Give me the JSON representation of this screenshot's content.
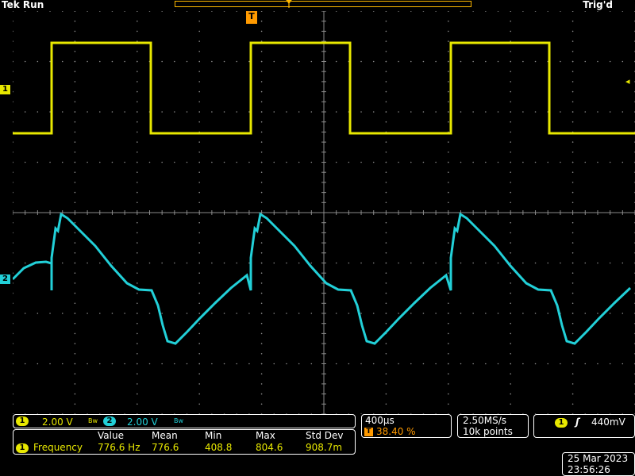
{
  "header": {
    "brand": "Tek",
    "status": "Run",
    "trigger_state": "Trig'd"
  },
  "markers": {
    "trigger_position": "T",
    "ch1": "1",
    "ch2": "2",
    "trigger_level": "◂"
  },
  "colors": {
    "ch1": "#e8e800",
    "ch2": "#22d0d8",
    "grid": "#8a8a8a",
    "trigger": "#ff9a00"
  },
  "channels": [
    {
      "num": "1",
      "scale": "2.00 V",
      "bw": "Bw",
      "color": "#e8e800"
    },
    {
      "num": "2",
      "scale": "2.00 V",
      "bw": "Bw",
      "color": "#22d0d8"
    }
  ],
  "measurement": {
    "headers": [
      "Value",
      "Mean",
      "Min",
      "Max",
      "Std Dev"
    ],
    "channel": "1",
    "name": "Frequency",
    "values": [
      "776.6 Hz",
      "776.6",
      "408.8",
      "804.6",
      "908.7m"
    ]
  },
  "timebase": {
    "scale": "400µs",
    "trigger_marker": "T",
    "position": "38.40 %"
  },
  "acquisition": {
    "sample_rate": "2.50MS/s",
    "record_length": "10k points"
  },
  "trigger": {
    "source": "1",
    "slope_icon": "rising-edge",
    "slope_glyph": "ʃ",
    "level": "440mV"
  },
  "datetime": {
    "date": "25 Mar  2023",
    "time": "23:56:26"
  }
}
